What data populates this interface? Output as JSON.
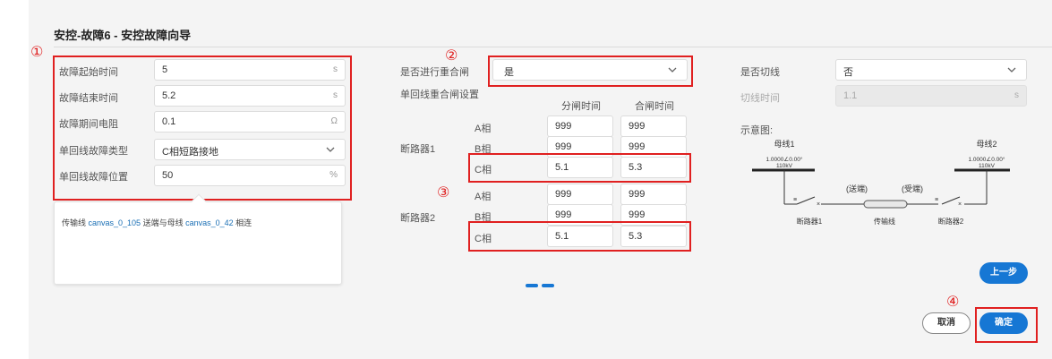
{
  "title": "安控-故障6 - 安控故障向导",
  "markers": [
    "①",
    "②",
    "③",
    "④"
  ],
  "left": {
    "fields": [
      {
        "label": "故障起始时间",
        "value": "5",
        "unit": "s"
      },
      {
        "label": "故障结束时间",
        "value": "5.2",
        "unit": "s"
      },
      {
        "label": "故障期间电阻",
        "value": "0.1",
        "unit": "Ω"
      },
      {
        "label": "单回线故障类型",
        "value": "C相短路接地",
        "unit": ""
      },
      {
        "label": "单回线故障位置",
        "value": "50",
        "unit": "%"
      }
    ],
    "info": {
      "prefix": "传输线 ",
      "line": "canvas_0_105",
      "mid": " 送端与母线 ",
      "bus": "canvas_0_42",
      "suffix": " 相连"
    }
  },
  "middle": {
    "reclose_label": "是否进行重合闸",
    "reclose_value": "是",
    "settings_label": "单回线重合闸设置",
    "col_open": "分闸时间",
    "col_close": "合闸时间",
    "breakers": [
      {
        "name": "断路器1",
        "phases": [
          {
            "phase": "A相",
            "open": "999",
            "close": "999"
          },
          {
            "phase": "B相",
            "open": "999",
            "close": "999"
          },
          {
            "phase": "C相",
            "open": "5.1",
            "close": "5.3"
          }
        ]
      },
      {
        "name": "断路器2",
        "phases": [
          {
            "phase": "A相",
            "open": "999",
            "close": "999"
          },
          {
            "phase": "B相",
            "open": "999",
            "close": "999"
          },
          {
            "phase": "C相",
            "open": "5.1",
            "close": "5.3"
          }
        ]
      }
    ]
  },
  "right": {
    "cut_label": "是否切线",
    "cut_value": "否",
    "cut_time_label": "切线时间",
    "cut_time_value": "1.1",
    "cut_time_unit": "s",
    "diagram_label": "示意图:",
    "diagram": {
      "bus1": "母线1",
      "bus2": "母线2",
      "bus1_value": "1.0000∠0.00°",
      "bus1_kv": "110kV",
      "bus2_value": "1.0000∠0.00°",
      "bus2_kv": "110kV",
      "send": "(送端)",
      "recv": "(受端)",
      "breaker1": "断路器1",
      "line": "传输线",
      "breaker2": "断路器2"
    }
  },
  "buttons": {
    "prev": "上一步",
    "cancel": "取消",
    "confirm": "确定"
  },
  "colors": {
    "accent": "#1677d4",
    "highlight": "#e02020"
  }
}
